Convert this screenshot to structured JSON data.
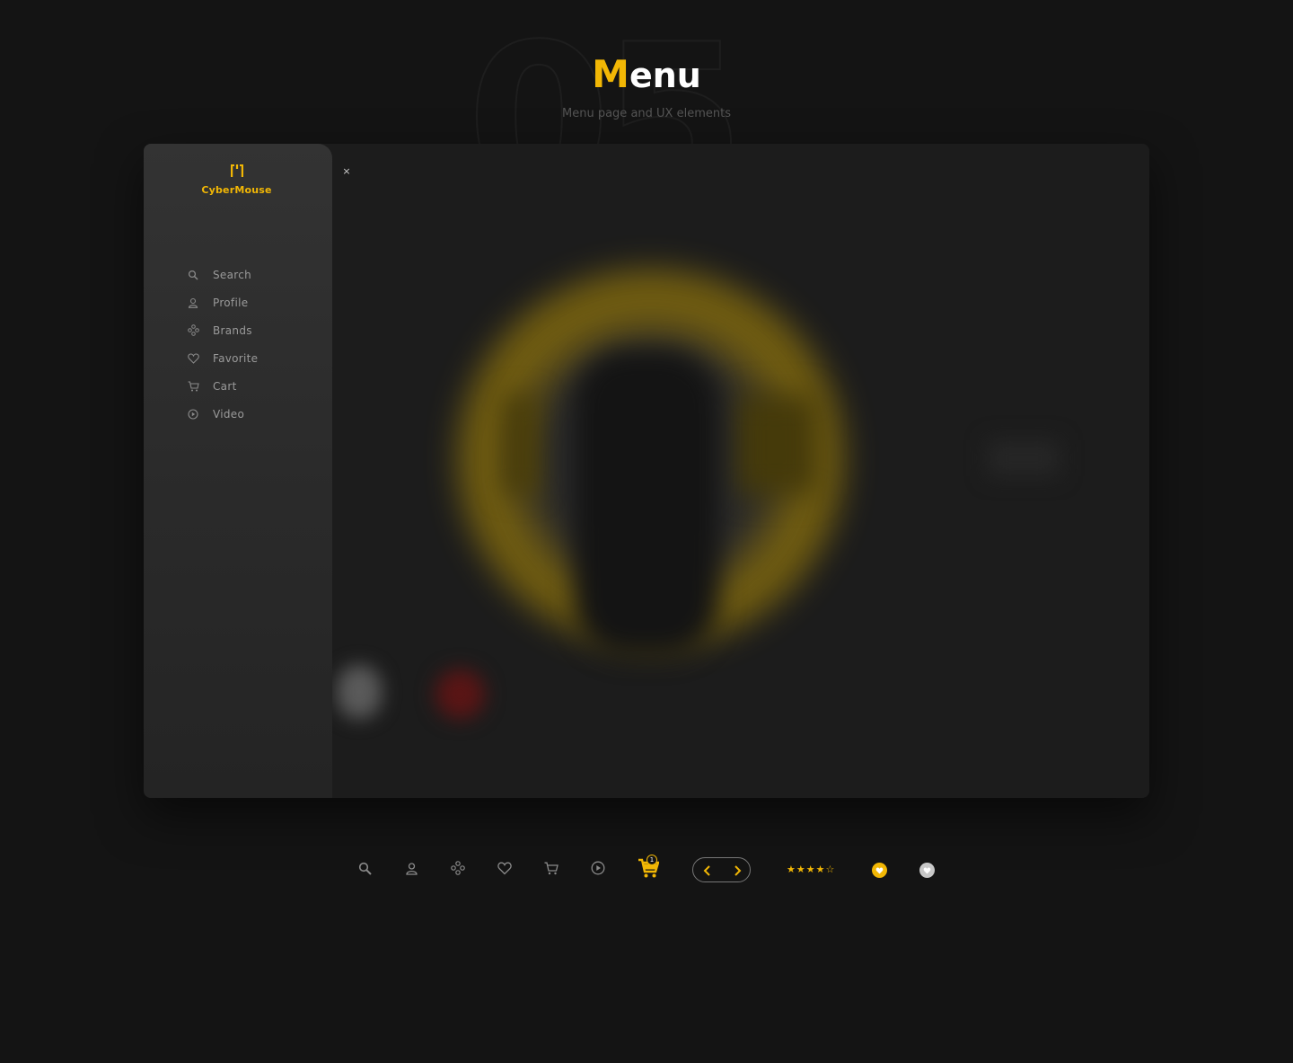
{
  "header": {
    "background_number": "05",
    "title_initial": "M",
    "title_rest": "enu",
    "subtitle": "Menu page and UX elements"
  },
  "brand": {
    "name": "CyberMouse",
    "accent_color": "#f2b705"
  },
  "drawer": {
    "close_label": "×",
    "items": [
      {
        "label": "Search",
        "icon": "search-icon"
      },
      {
        "label": "Profile",
        "icon": "user-icon"
      },
      {
        "label": "Brands",
        "icon": "brands-icon"
      },
      {
        "label": "Favorite",
        "icon": "heart-icon"
      },
      {
        "label": "Cart",
        "icon": "cart-icon"
      },
      {
        "label": "Video",
        "icon": "play-icon"
      }
    ]
  },
  "ux_elements": {
    "icons": [
      "search-icon",
      "user-icon",
      "brands-icon",
      "heart-icon",
      "cart-icon",
      "play-icon"
    ],
    "cart_badge_count": "1",
    "pager": {
      "prev": "previous-chevron-icon",
      "next": "next-chevron-icon"
    },
    "rating": {
      "value": 4,
      "max": 5,
      "filled_stars": "★★★★",
      "empty_stars": "☆"
    },
    "favorite_active": "favorite-active-icon",
    "favorite_inactive": "favorite-inactive-icon"
  }
}
